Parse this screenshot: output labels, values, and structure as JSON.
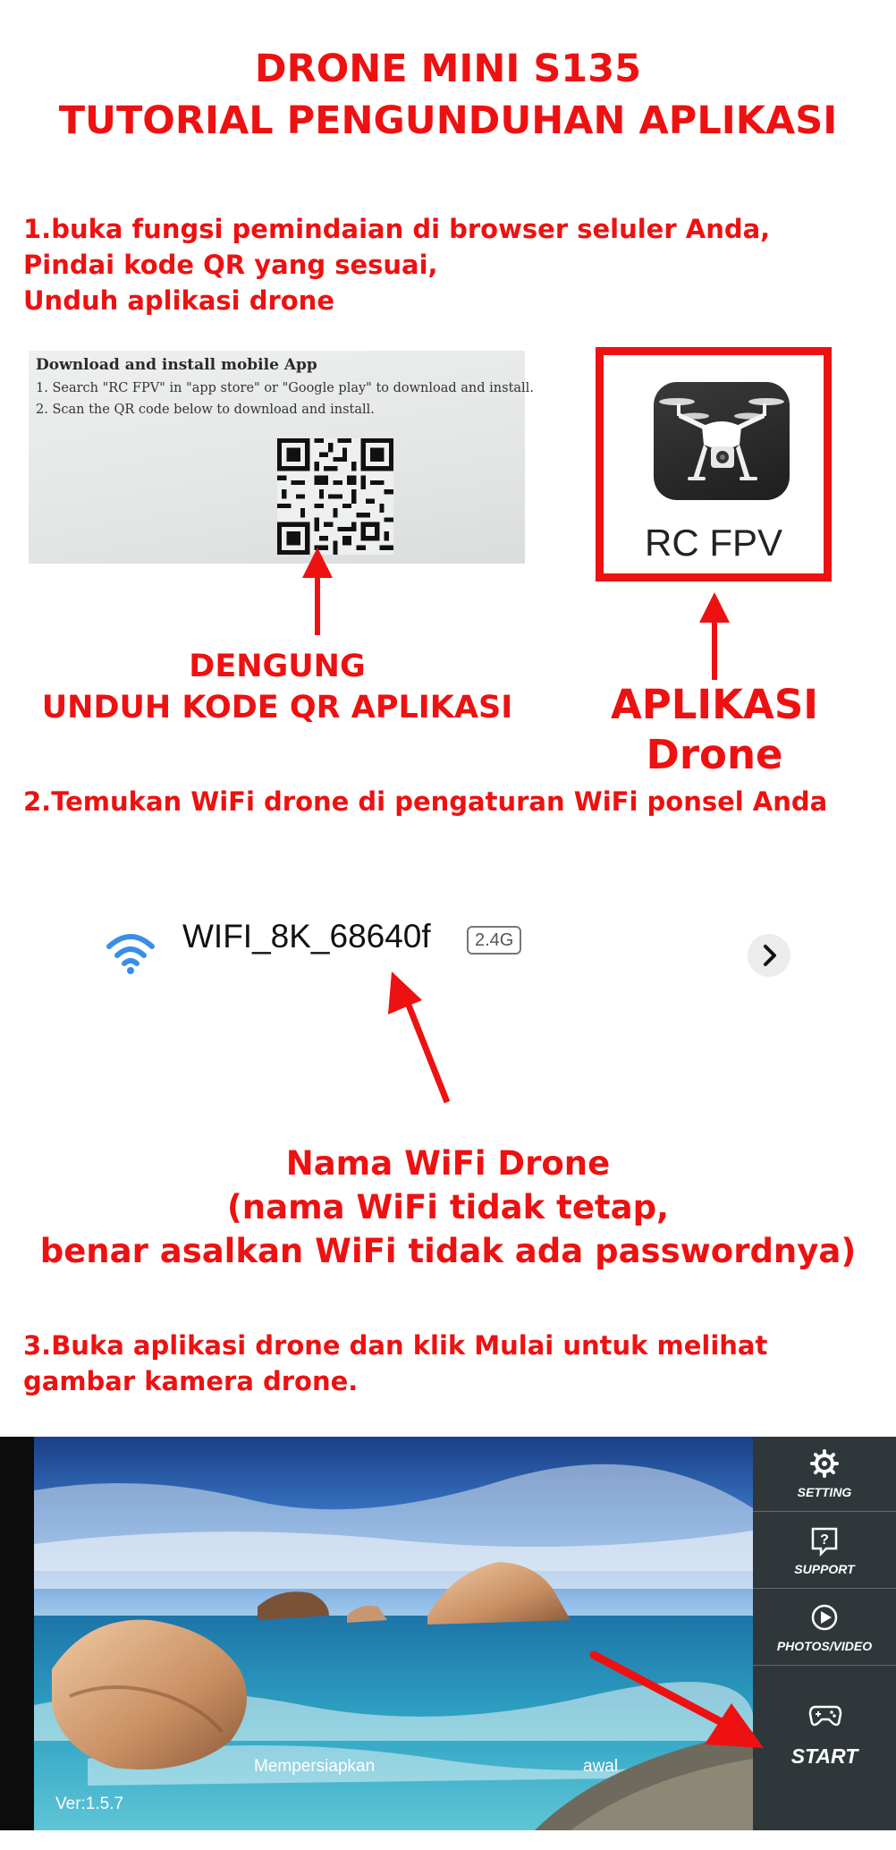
{
  "title": {
    "line1": "DRONE MINI S135",
    "line2": "TUTORIAL PENGUNDUHAN APLIKASI"
  },
  "step1": {
    "line1": "1.buka fungsi pemindaian di browser seluler Anda,",
    "line2": "Pindai kode QR yang sesuai,",
    "line3": "Unduh aplikasi drone"
  },
  "qr_card": {
    "heading": "Download and install mobile App",
    "line1": "1. Search \"RC FPV\" in \"app store\" or \"Google play\" to download and install.",
    "line2": "2. Scan the QR code below to download and install."
  },
  "qr_caption": {
    "line1": "DENGUNG",
    "line2": "UNDUH KODE QR APLIKASI"
  },
  "app_box": {
    "name": "RC FPV"
  },
  "app_caption": "APLIKASI Drone",
  "step2": {
    "line1": "2.Temukan WiFi drone di pengaturan WiFi ponsel Anda"
  },
  "wifi": {
    "name": "WIFI_8K_68640f",
    "band": "2.4G",
    "icon": "wifi-icon",
    "chevron_icon": "chevron-right-icon"
  },
  "wifi_caption": {
    "line1": "Nama WiFi Drone",
    "line2": "(nama WiFi tidak tetap,",
    "line3": "benar asalkan WiFi tidak ada passwordnya)"
  },
  "step3": {
    "line1": "3.Buka aplikasi drone dan klik Mulai untuk melihat",
    "line2": "gambar kamera drone."
  },
  "app_screen": {
    "menu": [
      {
        "label": "SETTING",
        "icon": "gear-icon"
      },
      {
        "label": "SUPPORT",
        "icon": "help-icon"
      },
      {
        "label": "PHOTOS/VIDEO",
        "icon": "play-icon"
      }
    ],
    "start_label": "START",
    "start_icon": "gamepad-icon",
    "status_left": "Mempersiapkan",
    "status_right": "awal",
    "version": "Ver:1.5.7"
  },
  "colors": {
    "accent": "#ee1111",
    "wifi_blue": "#3a8ee6"
  }
}
